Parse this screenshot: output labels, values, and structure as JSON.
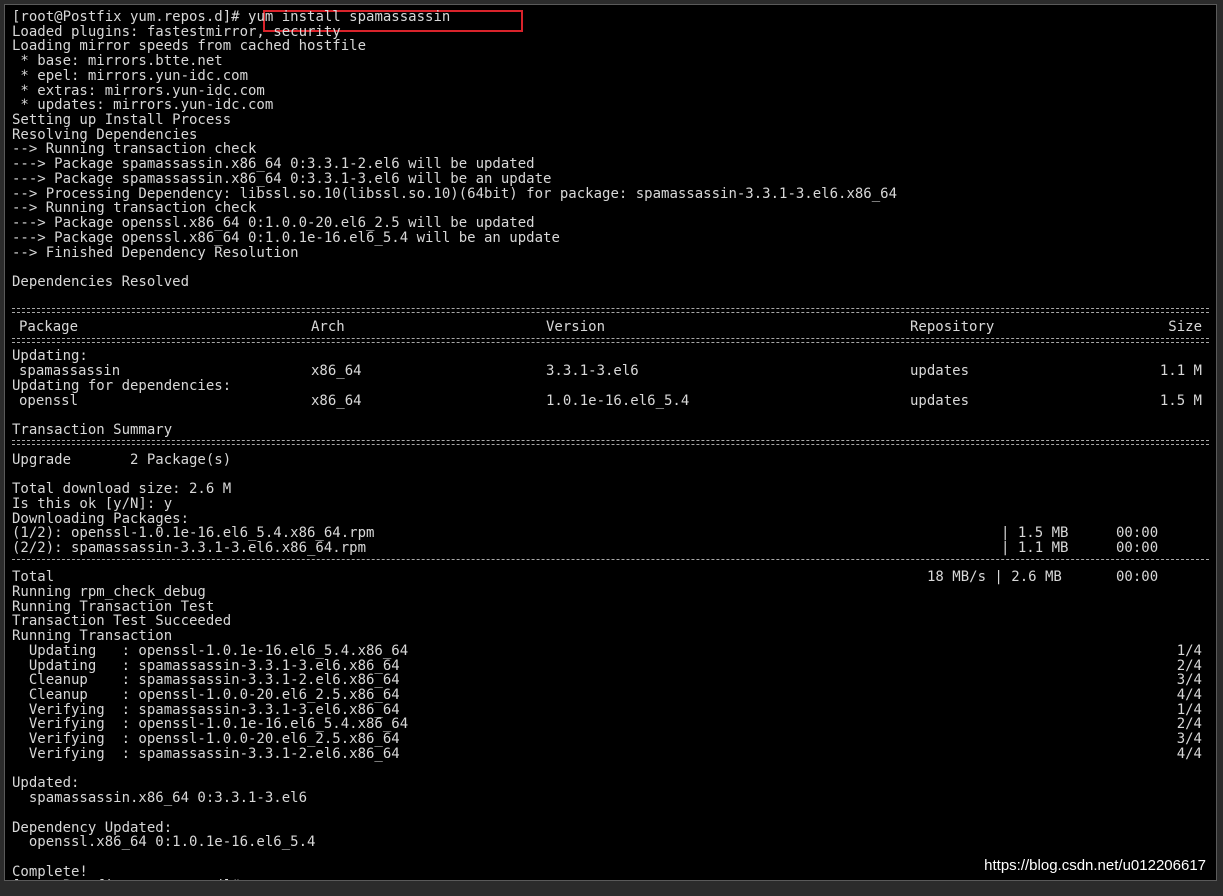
{
  "terminal": {
    "prompt": "[root@Postfix yum.repos.d]# ",
    "command": "yum install spamassassin",
    "pre_lines": [
      "Loaded plugins: fastestmirror, security",
      "Loading mirror speeds from cached hostfile",
      " * base: mirrors.btte.net",
      " * epel: mirrors.yun-idc.com",
      " * extras: mirrors.yun-idc.com",
      " * updates: mirrors.yun-idc.com",
      "Setting up Install Process",
      "Resolving Dependencies",
      "--> Running transaction check",
      "---> Package spamassassin.x86_64 0:3.3.1-2.el6 will be updated",
      "---> Package spamassassin.x86_64 0:3.3.1-3.el6 will be an update",
      "--> Processing Dependency: libssl.so.10(libssl.so.10)(64bit) for package: spamassassin-3.3.1-3.el6.x86_64",
      "--> Running transaction check",
      "---> Package openssl.x86_64 0:1.0.0-20.el6_2.5 will be updated",
      "---> Package openssl.x86_64 0:1.0.1e-16.el6_5.4 will be an update",
      "--> Finished Dependency Resolution",
      "",
      "Dependencies Resolved"
    ],
    "pkg_table": {
      "headers": {
        "package": "Package",
        "arch": "Arch",
        "version": "Version",
        "repository": "Repository",
        "size": "Size"
      },
      "updating_label": "Updating:",
      "updating_deps_label": "Updating for dependencies:",
      "rows": [
        {
          "package": "spamassassin",
          "arch": "x86_64",
          "version": "3.3.1-3.el6",
          "repository": "updates",
          "size": "1.1 M"
        },
        {
          "package": "openssl",
          "arch": "x86_64",
          "version": "1.0.1e-16.el6_5.4",
          "repository": "updates",
          "size": "1.5 M"
        }
      ]
    },
    "summary_title": "Transaction Summary",
    "upgrade_line": "Upgrade       2 Package(s)",
    "download_lines": [
      "Total download size: 2.6 M",
      "Is this ok [y/N]: y",
      "Downloading Packages:"
    ],
    "downloads": [
      {
        "name": "(1/2): openssl-1.0.1e-16.el6_5.4.x86_64.rpm",
        "size": "| 1.5 MB",
        "time": "00:00"
      },
      {
        "name": "(2/2): spamassassin-3.3.1-3.el6.x86_64.rpm",
        "size": "| 1.1 MB",
        "time": "00:00"
      }
    ],
    "total": {
      "label": "Total",
      "rate": "18 MB/s | 2.6 MB",
      "time": "00:00"
    },
    "run_lines": [
      "Running rpm_check_debug",
      "Running Transaction Test",
      "Transaction Test Succeeded",
      "Running Transaction"
    ],
    "steps": [
      {
        "action": "  Updating   : openssl-1.0.1e-16.el6_5.4.x86_64",
        "count": "1/4"
      },
      {
        "action": "  Updating   : spamassassin-3.3.1-3.el6.x86_64",
        "count": "2/4"
      },
      {
        "action": "  Cleanup    : spamassassin-3.3.1-2.el6.x86_64",
        "count": "3/4"
      },
      {
        "action": "  Cleanup    : openssl-1.0.0-20.el6_2.5.x86_64",
        "count": "4/4"
      },
      {
        "action": "  Verifying  : spamassassin-3.3.1-3.el6.x86_64",
        "count": "1/4"
      },
      {
        "action": "  Verifying  : openssl-1.0.1e-16.el6_5.4.x86_64",
        "count": "2/4"
      },
      {
        "action": "  Verifying  : openssl-1.0.0-20.el6_2.5.x86_64",
        "count": "3/4"
      },
      {
        "action": "  Verifying  : spamassassin-3.3.1-2.el6.x86_64",
        "count": "4/4"
      }
    ],
    "post_lines": [
      "",
      "Updated:",
      "  spamassassin.x86_64 0:3.3.1-3.el6",
      "",
      "Dependency Updated:",
      "  openssl.x86_64 0:1.0.1e-16.el6_5.4",
      "",
      "Complete!",
      "[root@Postfix yum.repos.d]#"
    ]
  },
  "watermark": "https://blog.csdn.net/u012206617",
  "colors": {
    "terminal_bg": "#000000",
    "terminal_text": "#d8d8d8",
    "highlight_box": "#d9232b"
  }
}
